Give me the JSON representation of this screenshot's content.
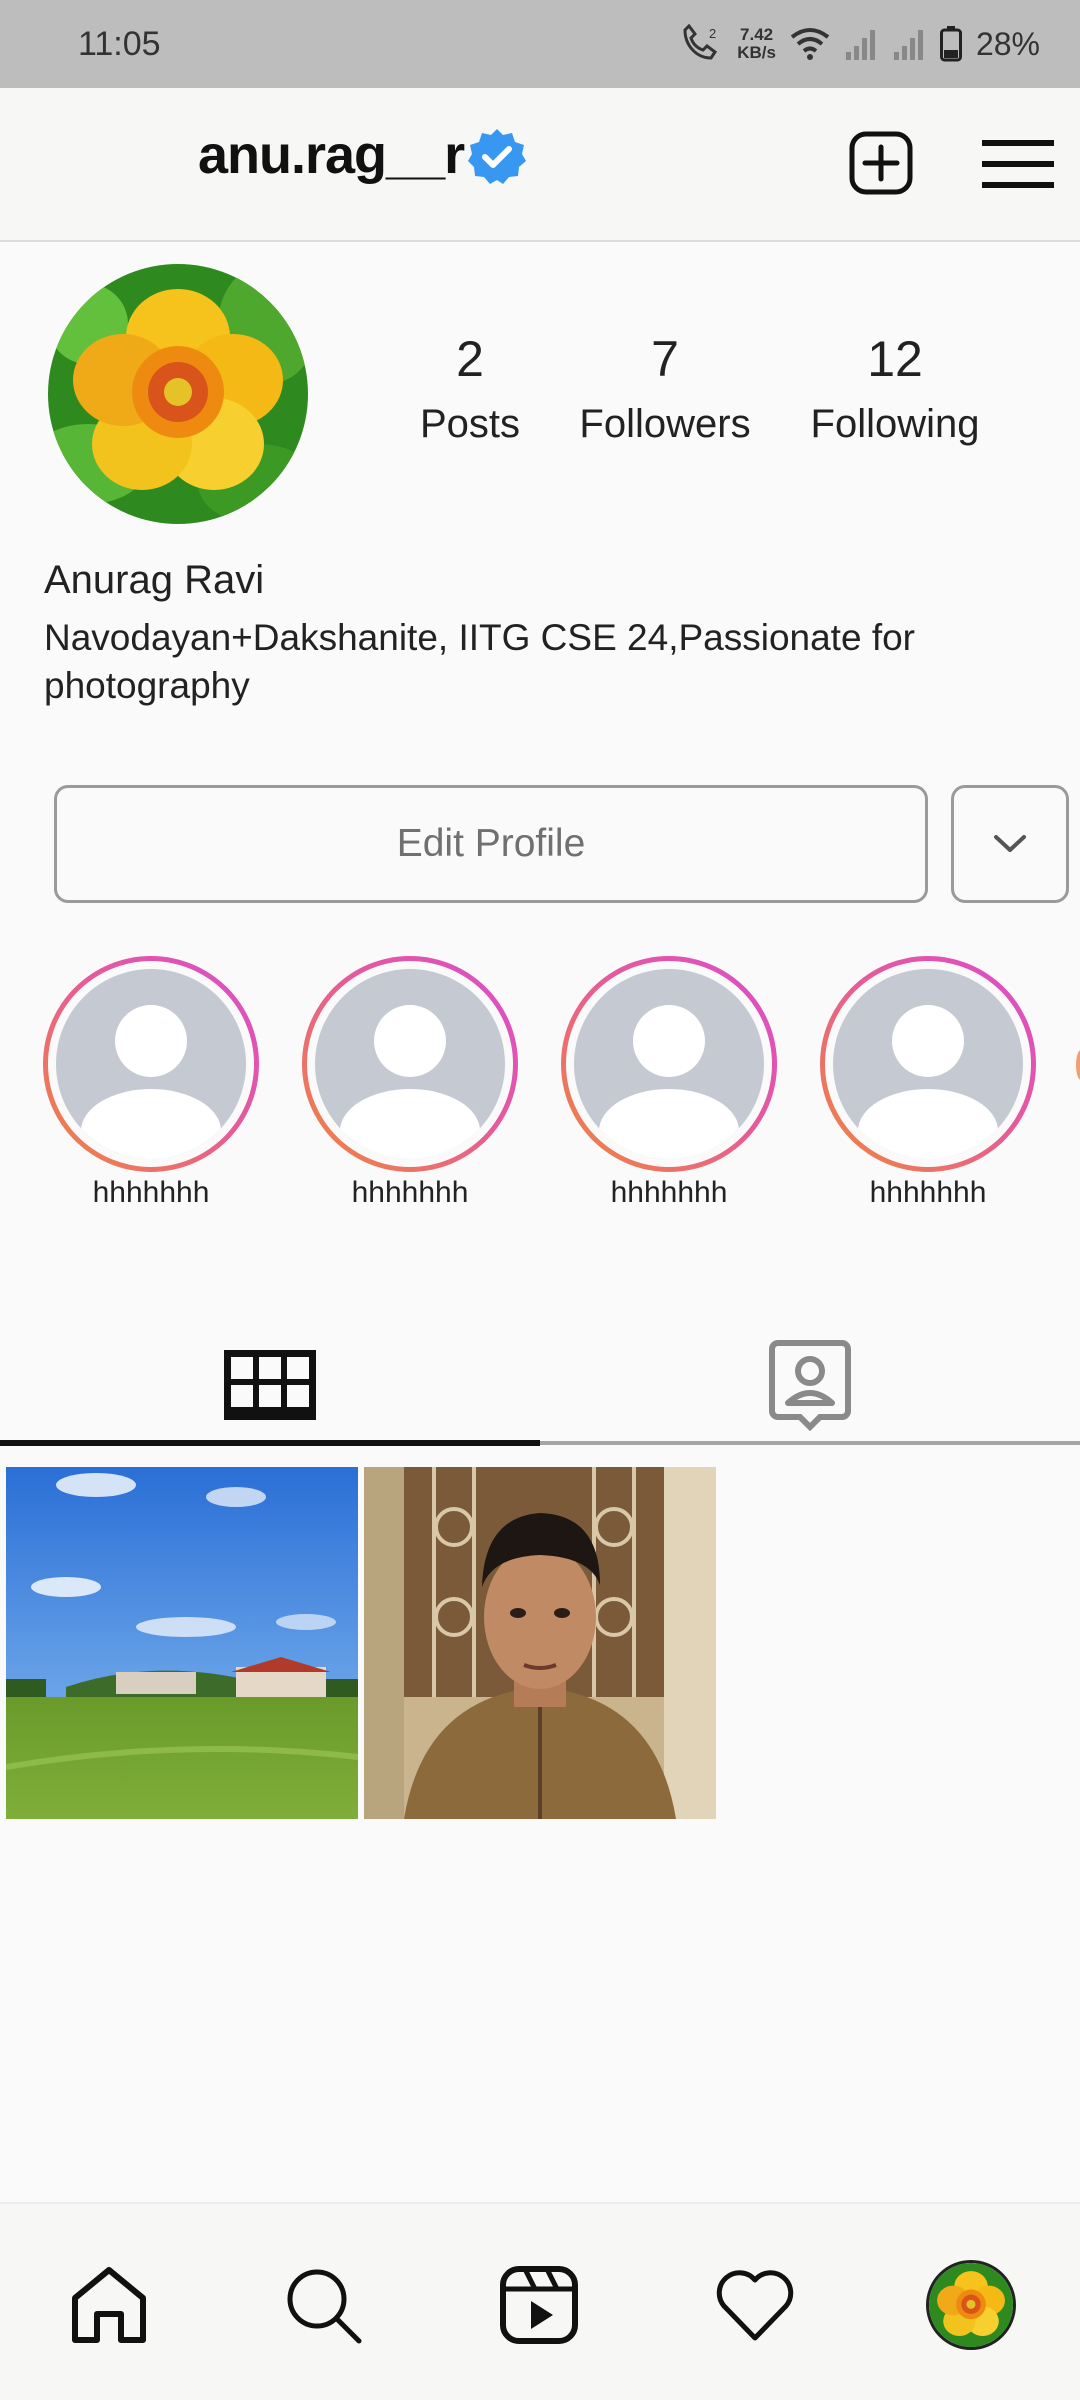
{
  "status_bar": {
    "time": "11:05",
    "net_speed_value": "7.42",
    "net_speed_unit": "KB/s",
    "battery": "28%",
    "icons": [
      "volte-call-icon",
      "wifi-icon",
      "signal-icon",
      "signal-icon",
      "battery-icon"
    ]
  },
  "header": {
    "username": "anu.rag__r",
    "verified": true,
    "icons": [
      "verified-badge-icon",
      "new-post-icon",
      "menu-icon"
    ]
  },
  "profile": {
    "stats": [
      {
        "value": "2",
        "label": "Posts"
      },
      {
        "value": "7",
        "label": "Followers"
      },
      {
        "value": "12",
        "label": "Following"
      }
    ],
    "full_name": "Anurag Ravi",
    "bio": "Navodayan+Dakshanite, IITG CSE 24,Passionate for photography",
    "edit_button": "Edit Profile"
  },
  "highlights": [
    {
      "label": "hhhhhhh"
    },
    {
      "label": "hhhhhhh"
    },
    {
      "label": "hhhhhhh"
    },
    {
      "label": "hhhhhhh"
    }
  ],
  "tabs": [
    {
      "name": "grid-icon",
      "active": true
    },
    {
      "name": "tagged-icon",
      "active": false
    }
  ],
  "posts_count_shown": 2,
  "bottom_nav": [
    "home-icon",
    "search-icon",
    "reels-icon",
    "heart-icon",
    "profile-avatar"
  ],
  "colors": {
    "verified": "#3897f0",
    "ring_start": "#f0883a",
    "ring_end": "#d84dd0",
    "status_bar": "#bdbdbd"
  }
}
